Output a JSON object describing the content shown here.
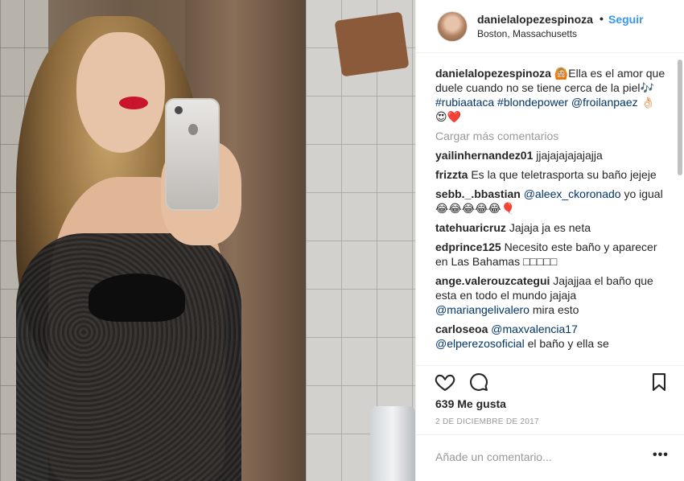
{
  "post": {
    "username": "danielalopezespinoza",
    "follow_label": "Seguir",
    "separator": "•",
    "location": "Boston, Massachusetts",
    "caption": {
      "username": "danielalopezespinoza",
      "text_1": "🙆🏼Ella es el amor que duele cuando no se tiene cerca de la piel🎶",
      "hashtags": "#rubiaataca #blondepower",
      "mention": "@froilanpaez",
      "emojis": "👌🏻😍❤️"
    },
    "load_more_label": "Cargar más comentarios",
    "comments": [
      {
        "user": "yailinhernandez01",
        "text": "jjajajajajajajja"
      },
      {
        "user": "frizzta",
        "text": "Es la que teletrasporta su baño jejeje"
      },
      {
        "user": "sebb._.bbastian",
        "mention": "@aleex_ckoronado",
        "text": "yo igual😂😂😂😂😂🎈"
      },
      {
        "user": "tatehuaricruz",
        "text": "Jajaja ja es neta"
      },
      {
        "user": "edprince125",
        "text": "Necesito este baño y aparecer en Las Bahamas □□□□□"
      },
      {
        "user": "ange.valerouzcategui",
        "text": "Jajajjaa el baño que esta en todo el mundo jajaja",
        "mention": "@mariangelivalero",
        "text_after": "mira esto"
      },
      {
        "user": "carloseoa",
        "mention": "@maxvalencia17",
        "mention_2": "@elperezosoficial",
        "text_after": "el baño y ella se"
      }
    ],
    "likes": "639 Me gusta",
    "date": "2 DE DICIEMBRE DE 2017",
    "comment_placeholder": "Añade un comentario...",
    "more_label": "•••"
  },
  "icons": {
    "like": "heart-icon",
    "comment": "comment-bubble-icon",
    "save": "bookmark-icon"
  },
  "colors": {
    "link": "#003569",
    "follow": "#3897f0",
    "muted": "#999999",
    "text": "#262626"
  }
}
